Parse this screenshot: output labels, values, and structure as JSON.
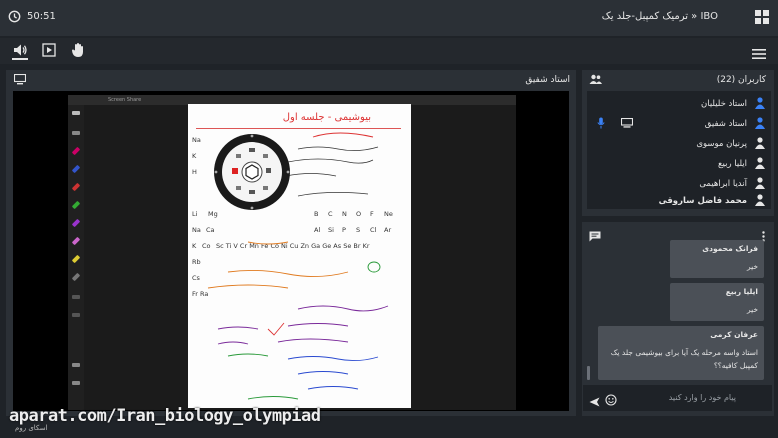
{
  "topbar": {
    "timer": "50:51",
    "title": "IBO « ترمیک کمپبل-جلد یک"
  },
  "presentation": {
    "title": "استاد شفیق",
    "screen_header": "Screen Share",
    "doc_heading": "بیوشیمی - جلسه اول"
  },
  "users": {
    "title": "کاربران (22)",
    "list": [
      {
        "name": "استاد خلیلیان"
      },
      {
        "name": "استاد شفیق"
      },
      {
        "name": "پرنیان موسوی"
      },
      {
        "name": "ایلیا ربیع"
      },
      {
        "name": "آندیا ابراهیمی"
      },
      {
        "name": "محمد فاضل ساروقی"
      }
    ]
  },
  "chat": {
    "messages": [
      {
        "name": "فرانک محمودی",
        "text": "خیر"
      },
      {
        "name": "ایلیا ربیع",
        "text": "خیر"
      },
      {
        "name": "عرفان کرمی",
        "text": "استاد واسه مرحله یک آیا برای بیوشیمی جلد یک کمپبل کافیه؟؟"
      }
    ],
    "placeholder": "پیام خود را وارد کنید"
  },
  "watermark": {
    "text": "aparat.com/Iran_biology_olympiad",
    "sub": "اسکای روم"
  },
  "colors": {
    "accent": "#3b82f6",
    "panel": "#2b3036",
    "bg": "#1f2328",
    "message": "#4b5057"
  }
}
